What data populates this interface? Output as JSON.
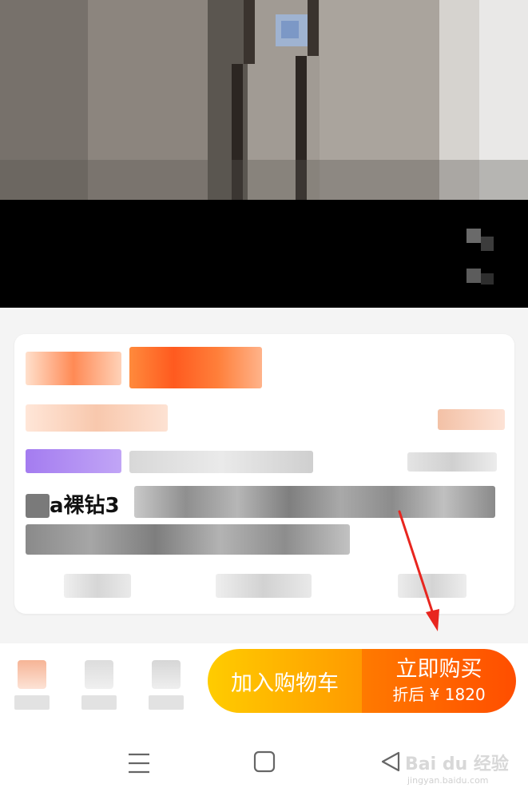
{
  "product": {
    "title_fragment": "a裸钻3"
  },
  "action_bar": {
    "add_to_cart_label": "加入购物车",
    "buy_now_label": "立即购买",
    "buy_now_price": "折后 ¥ 1820",
    "cart_gradient": [
      "#ffcc00",
      "#ff9a00"
    ],
    "buy_gradient": [
      "#ff7a00",
      "#ff4e00"
    ]
  },
  "annotation": {
    "arrow_color": "#e8261f"
  },
  "system_nav": {
    "menu_icon": "menu-icon",
    "home_icon": "home-icon",
    "back_icon": "back-icon"
  },
  "watermark": {
    "logo_text": "Bai du 经验",
    "url": "jingyan.baidu.com"
  }
}
